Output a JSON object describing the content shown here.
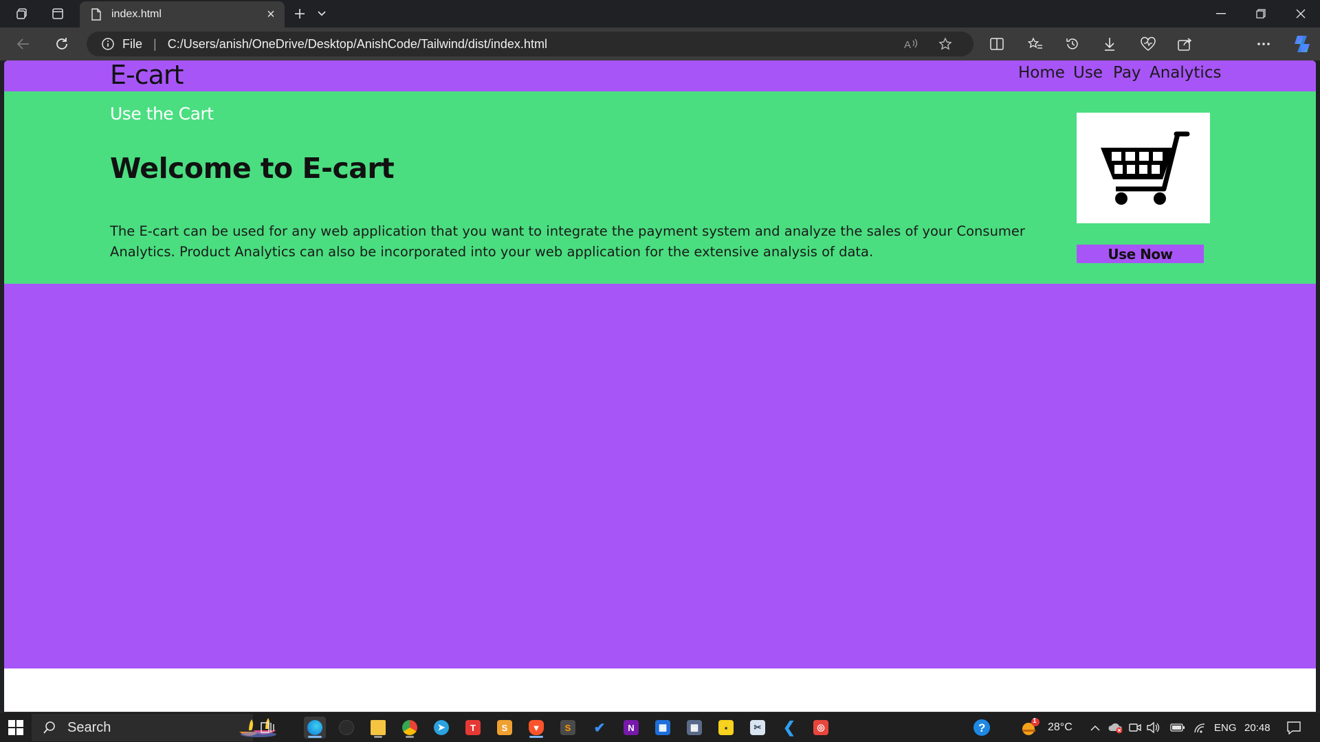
{
  "browser": {
    "tab_title": "index.html",
    "address_scheme": "File",
    "address_url": "C:/Users/anish/OneDrive/Desktop/AnishCode/Tailwind/dist/index.html"
  },
  "page": {
    "brand": "E-cart",
    "nav": [
      "Home",
      "Use",
      "Pay",
      "Analytics"
    ],
    "hero_kicker": "Use the Cart",
    "hero_title": "Welcome to E-cart",
    "hero_body": "The E-cart can be used for any web application that you want to integrate the payment system and analyze the sales of your Consumer Analytics. Product Analytics can also be incorporated into your web application for the extensive analysis of data.",
    "cta_label": "Use Now",
    "colors": {
      "nav_bg": "#a855f7",
      "hero_bg": "#4ade80",
      "button_bg": "#a855f7"
    }
  },
  "taskbar": {
    "search_label": "Search",
    "temperature": "28°C",
    "weather_badge": "1",
    "language": "ENG",
    "time": "20:48"
  }
}
